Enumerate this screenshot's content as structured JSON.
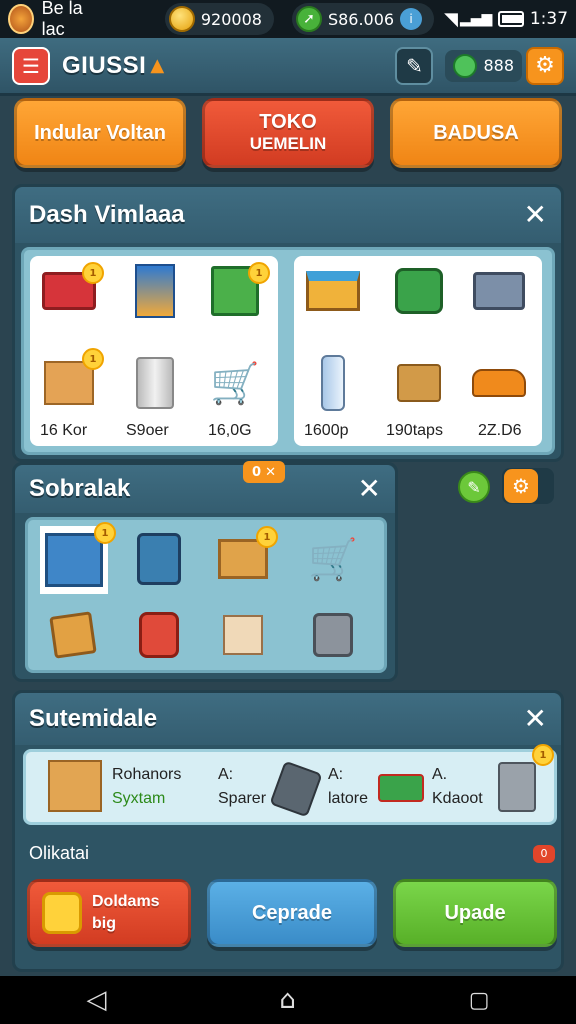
{
  "status_bar": {
    "app_label": "Be la lac",
    "coins": "920008",
    "cash": "S86.006",
    "clock": "1:37"
  },
  "top_bar": {
    "title": "GIUSSI",
    "gems": "888"
  },
  "action_buttons": {
    "left": "Indular Voltan",
    "center_line1": "TOKO",
    "center_line2": "UEMELIN",
    "right": "BADUSA"
  },
  "panel_dash": {
    "title": "Dash Vimlaaa",
    "left_labels": [
      "16 Kor",
      "S9oer",
      "16,0G"
    ],
    "right_labels": [
      "1600p",
      "190taps",
      "2Z.D6"
    ]
  },
  "panel_sobralak": {
    "title": "Sobralak",
    "tab_badge": "0"
  },
  "panel_sutem": {
    "title": "Sutemidale",
    "row": [
      {
        "name": "Rohanors",
        "sub": "Syxtam"
      },
      {
        "name": "A:",
        "sub": "Sparer"
      },
      {
        "name": "A:",
        "sub": "latore"
      },
      {
        "name": "A.",
        "sub": "Kdaoot"
      }
    ],
    "section_label": "Olikatai",
    "section_count": "0"
  },
  "bottom_buttons": {
    "left_line1": "Doldams",
    "left_line2": "big",
    "center": "Ceprade",
    "right": "Upade"
  },
  "colors": {
    "orange": "#f7941d",
    "red": "#e2452a",
    "blue": "#4a9fd6",
    "green": "#6cc83a",
    "panel": "#2e5464"
  }
}
